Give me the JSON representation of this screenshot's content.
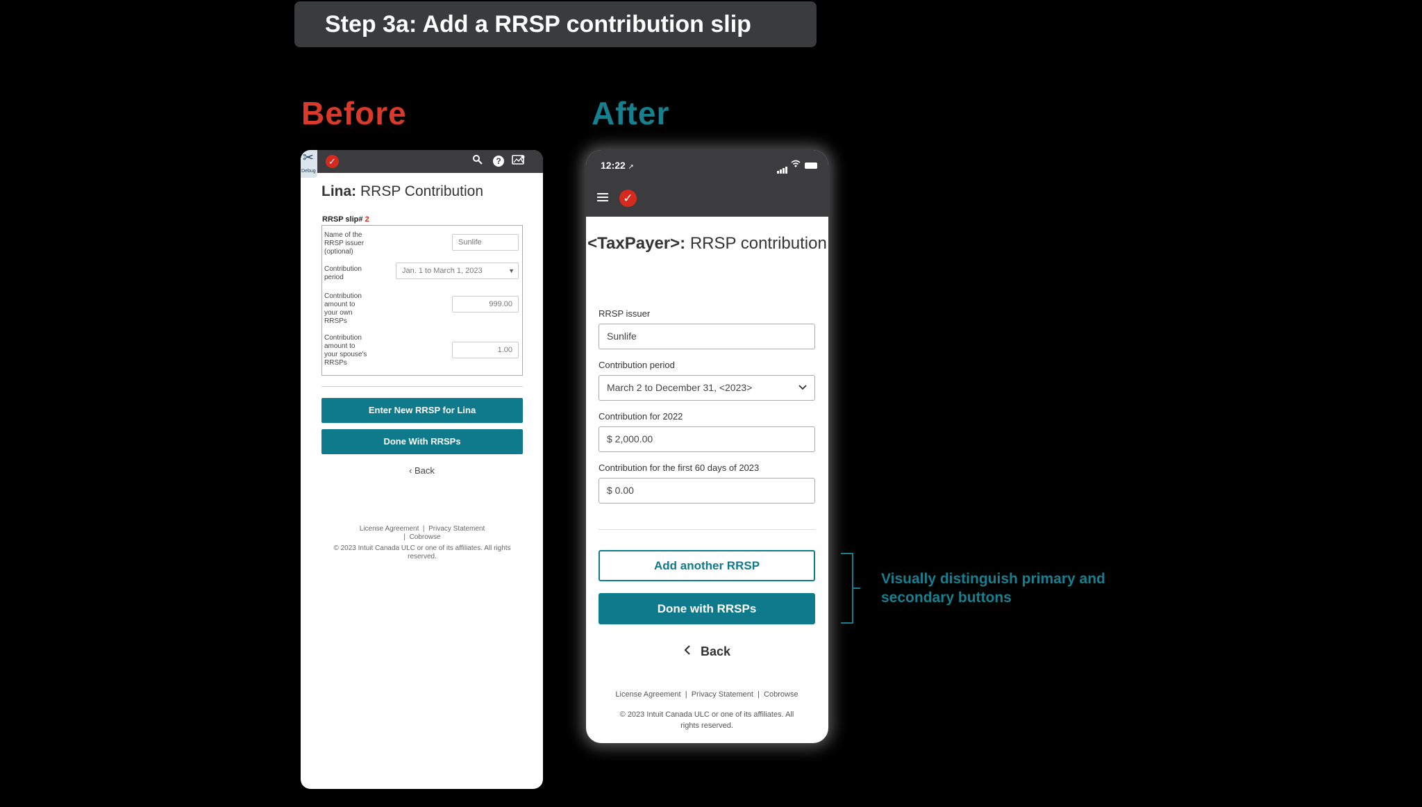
{
  "banner": {
    "title": "Step 3a: Add a RRSP contribution slip"
  },
  "headings": {
    "before": "Before",
    "after": "After"
  },
  "before": {
    "debug_label": "Debug",
    "title_bold": "Lina:",
    "title_rest": " RRSP Contribution",
    "slip_label": "RRSP slip#",
    "slip_number": "2",
    "fields": [
      {
        "label": "Name of the RRSP issuer (optional)",
        "value": "Sunlife"
      },
      {
        "label": "Contribution period",
        "value": "Jan. 1 to March 1, 2023"
      },
      {
        "label": "Contribution amount to your own RRSPs",
        "value": "999.00"
      },
      {
        "label": "Contribution amount to your spouse's RRSPs",
        "value": "1.00"
      }
    ],
    "btn_enter_new": "Enter New RRSP for Lina",
    "btn_done": "Done With RRSPs",
    "back": "Back",
    "footer_links": [
      "License Agreement",
      "Privacy Statement",
      "Cobrowse"
    ],
    "copyright": "© 2023 Intuit Canada ULC or one of its affiliates. All rights reserved."
  },
  "after": {
    "time": "12:22",
    "title_bold": "<TaxPayer>:",
    "title_rest": " RRSP contribution",
    "fields": [
      {
        "label": "RRSP issuer",
        "value": "Sunlife"
      },
      {
        "label": "Contribution period",
        "value": "March 2 to December 31, <2023>"
      },
      {
        "label": "Contribution for 2022",
        "value": "$ 2,000.00"
      },
      {
        "label": "Contribution for the first 60 days of 2023",
        "value": "$ 0.00"
      }
    ],
    "btn_add_another": "Add another RRSP",
    "btn_done": "Done with RRSPs",
    "back": "Back",
    "footer_links": [
      "License Agreement",
      "Privacy Statement",
      "Cobrowse"
    ],
    "copyright": "© 2023 Intuit Canada ULC or one of its affiliates. All rights reserved."
  },
  "annotation": {
    "text": "Visually distinguish primary and secondary buttons"
  },
  "colors": {
    "brand_teal": "#0f7a8c",
    "before_red": "#d93a2b",
    "after_teal": "#17808f",
    "check_red": "#d52b1e"
  }
}
